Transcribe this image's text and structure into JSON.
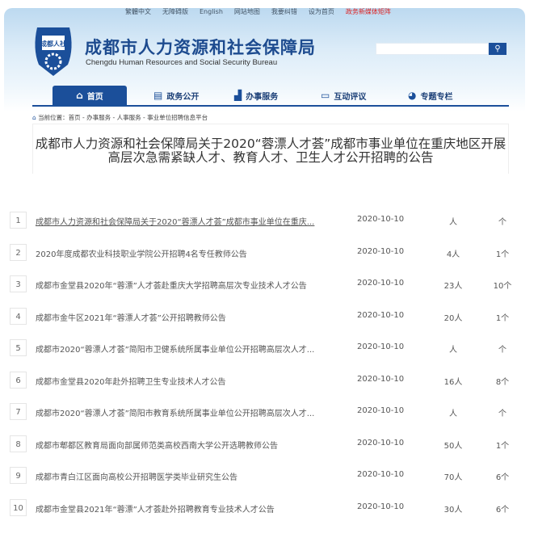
{
  "top_links": [
    "繁體中文",
    "无障碍版",
    "English",
    "网站地图",
    "我要纠错",
    "设为首页",
    "政务新媒体矩阵"
  ],
  "header": {
    "logo_text": "成都人社",
    "title": "成都市人力资源和社会保障局",
    "subtitle": "Chengdu Human Resources and Social Security Bureau",
    "search_placeholder": "",
    "accent": "#1b4f9a"
  },
  "nav": [
    {
      "label": "首页",
      "icon": "home-icon"
    },
    {
      "label": "政务公开",
      "icon": "document-icon"
    },
    {
      "label": "办事服务",
      "icon": "chart-icon"
    },
    {
      "label": "互动评议",
      "icon": "chat-icon"
    },
    {
      "label": "专题专栏",
      "icon": "topic-icon"
    }
  ],
  "breadcrumb": {
    "prefix": "当前位置：",
    "path": "首页 - 办事服务 - 人事服务 - 事业单位招聘信息平台"
  },
  "article_title": "成都市人力资源和社会保障局关于2020“蓉漂人才荟”成都市事业单位在重庆地区开展高层次急需紧缺人才、教育人才、卫生人才公开招聘的公告",
  "rows": [
    {
      "n": "1",
      "title": "成都市人力资源和社会保障局关于2020“蓉漂人才荟”成都市事业单位在重庆...",
      "date": "2020-10-10",
      "people": "人",
      "count": "个"
    },
    {
      "n": "2",
      "title": "2020年度成都农业科技职业学院公开招聘4名专任教师公告",
      "date": "2020-10-10",
      "people": "4人",
      "count": "1个"
    },
    {
      "n": "3",
      "title": "成都市金堂县2020年“蓉漂”人才荟赴重庆大学招聘高层次专业技术人才公告",
      "date": "2020-10-10",
      "people": "23人",
      "count": "10个"
    },
    {
      "n": "4",
      "title": "成都市金牛区2021年“蓉漂人才荟”公开招聘教师公告",
      "date": "2020-10-10",
      "people": "20人",
      "count": "1个"
    },
    {
      "n": "5",
      "title": "成都市2020“蓉漂人才荟”简阳市卫健系统所属事业单位公开招聘高层次人才...",
      "date": "2020-10-10",
      "people": "人",
      "count": "个"
    },
    {
      "n": "6",
      "title": "成都市金堂县2020年赴外招聘卫生专业技术人才公告",
      "date": "2020-10-10",
      "people": "16人",
      "count": "8个"
    },
    {
      "n": "7",
      "title": "成都市2020“蓉漂人才荟”简阳市教育系统所属事业单位公开招聘高层次人才...",
      "date": "2020-10-10",
      "people": "人",
      "count": "个"
    },
    {
      "n": "8",
      "title": "成都市郫都区教育局面向部属师范类高校西南大学公开选聘教师公告",
      "date": "2020-10-10",
      "people": "50人",
      "count": "1个"
    },
    {
      "n": "9",
      "title": "成都市青白江区面向高校公开招聘医学类毕业研究生公告",
      "date": "2020-10-10",
      "people": "70人",
      "count": "6个"
    },
    {
      "n": "10",
      "title": "成都市金堂县2021年“蓉漂”人才荟赴外招聘教育专业技术人才公告",
      "date": "2020-10-10",
      "people": "30人",
      "count": "6个"
    }
  ]
}
